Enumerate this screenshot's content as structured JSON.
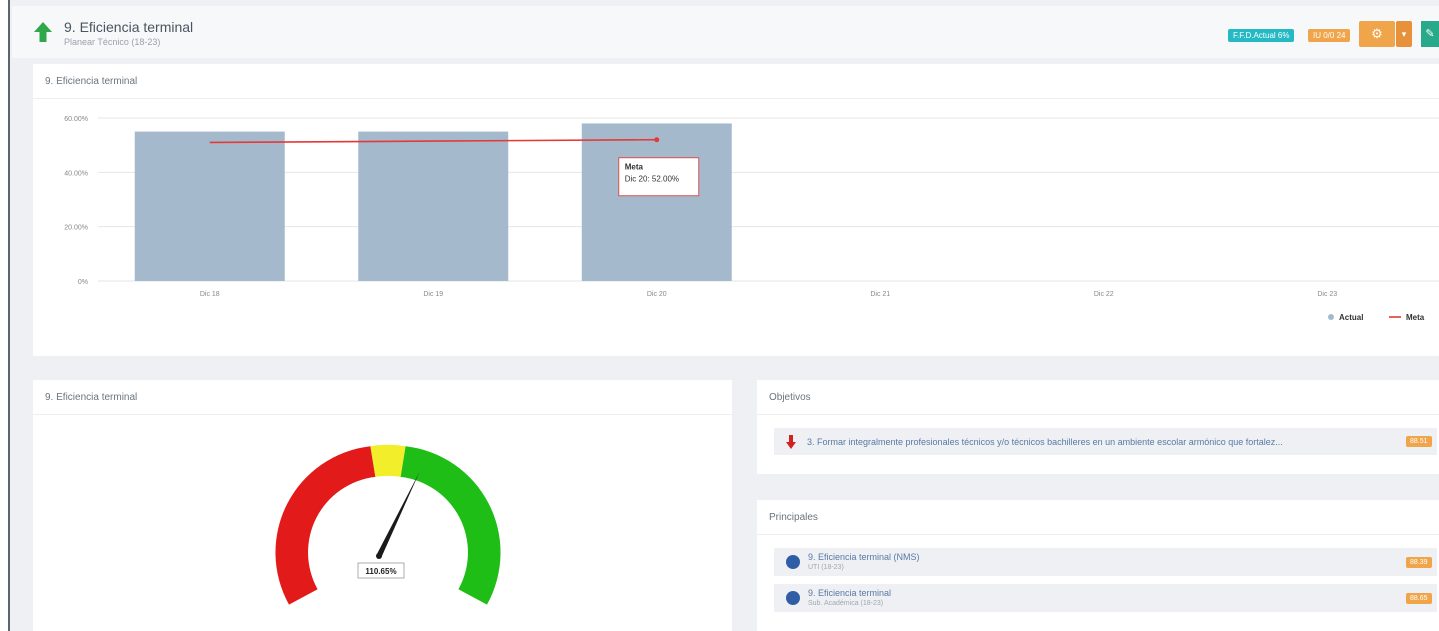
{
  "header": {
    "title": "9. Eficiencia terminal",
    "subtitle": "Planear Técnico (18-23)",
    "badge_cyan": "F.F.D.Actual 6%",
    "badge_orange": "IU 0/0 24",
    "gear_icon": "gear-icon",
    "caret_icon": "caret-down-icon",
    "action_icon": "pencil-icon"
  },
  "chart_panel": {
    "title": "9. Eficiencia terminal"
  },
  "chart_data": {
    "type": "bar",
    "categories": [
      "Dic 18",
      "Dic 19",
      "Dic 20",
      "Dic 21",
      "Dic 22",
      "Dic 23"
    ],
    "series": [
      {
        "name": "Actual",
        "type": "bar",
        "values": [
          55.0,
          55.0,
          58.0,
          null,
          null,
          null
        ],
        "color": "#a5b9cd"
      },
      {
        "name": "Meta",
        "type": "line",
        "values": [
          51.0,
          51.5,
          52.0,
          null,
          null,
          null
        ],
        "color": "#e53935"
      }
    ],
    "yticks": [
      "60.00%",
      "40.00%",
      "20.00%",
      "0%"
    ],
    "ylim": [
      0,
      60
    ],
    "tooltip": {
      "title": "Meta",
      "text": "Dic 20: 52.00%"
    },
    "legend": [
      "Actual",
      "Meta"
    ]
  },
  "gauge_panel": {
    "title": "9. Eficiencia terminal"
  },
  "gauge": {
    "value_label": "110.65%",
    "value": 110.65
  },
  "objetivos": {
    "title": "Objetivos",
    "item_text": "3. Formar integralmente profesionales técnicos y/o técnicos bachilleres en un ambiente escolar armónico que fortalez...",
    "item_tag": "88.51"
  },
  "principales": {
    "title": "Principales",
    "items": [
      {
        "name": "9. Eficiencia terminal (NMS)",
        "sub": "UTI (18-23)",
        "tag": "88.39"
      },
      {
        "name": "9. Eficiencia terminal",
        "sub": "Sub. Académica (18-23)",
        "tag": "88.65"
      }
    ]
  }
}
